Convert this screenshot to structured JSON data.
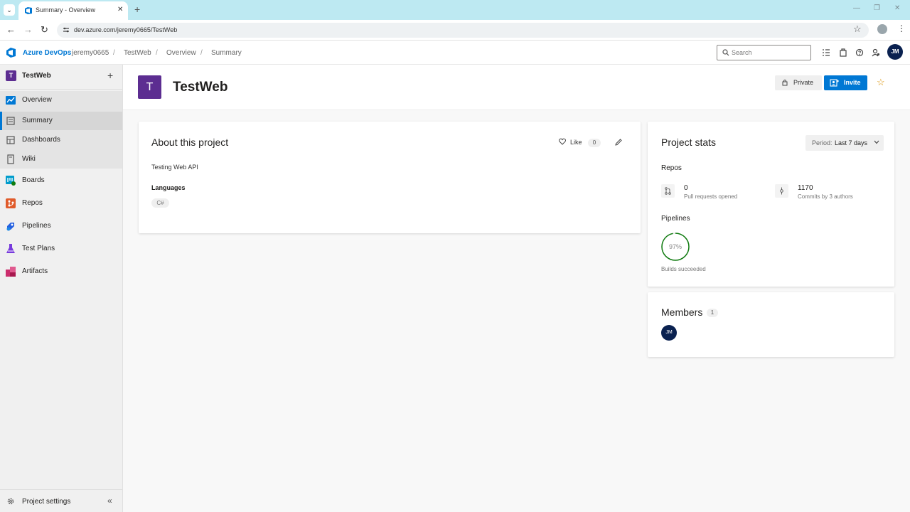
{
  "browser": {
    "tab_title": "Summary - Overview",
    "url": "dev.azure.com/jeremy0665/TestWeb"
  },
  "header": {
    "brand": "Azure DevOps",
    "breadcrumb": [
      "jeremy0665",
      "TestWeb",
      "Overview",
      "Summary"
    ],
    "search_placeholder": "Search",
    "user_initials": "JM"
  },
  "sidebar": {
    "project_initial": "T",
    "project_name": "TestWeb",
    "items": [
      {
        "label": "Overview",
        "icon": "overview-icon"
      },
      {
        "label": "Summary",
        "icon": "summary-icon",
        "selected": true
      },
      {
        "label": "Dashboards",
        "icon": "dashboards-icon"
      },
      {
        "label": "Wiki",
        "icon": "wiki-icon"
      },
      {
        "label": "Boards",
        "icon": "boards-icon"
      },
      {
        "label": "Repos",
        "icon": "repos-icon"
      },
      {
        "label": "Pipelines",
        "icon": "pipelines-icon"
      },
      {
        "label": "Test Plans",
        "icon": "test-plans-icon"
      },
      {
        "label": "Artifacts",
        "icon": "artifacts-icon"
      }
    ],
    "settings_label": "Project settings"
  },
  "project": {
    "initial": "T",
    "title": "TestWeb",
    "private_label": "Private",
    "invite_label": "Invite"
  },
  "about": {
    "title": "About this project",
    "like_label": "Like",
    "like_count": "0",
    "description": "Testing Web API",
    "languages_title": "Languages",
    "languages": [
      "C#"
    ]
  },
  "stats": {
    "title": "Project stats",
    "period_label": "Period:",
    "period_value": "Last 7 days",
    "repos_label": "Repos",
    "pull_requests_value": "0",
    "pull_requests_sub": "Pull requests opened",
    "commits_value": "1170",
    "commits_sub": "Commits by 3 authors",
    "pipelines_label": "Pipelines",
    "builds_percent": "97%",
    "builds_fraction": 0.97,
    "builds_sub": "Builds succeeded"
  },
  "members": {
    "title": "Members",
    "count": "1",
    "member_initials": "JM"
  },
  "colors": {
    "accent": "#0078d4",
    "project_badge": "#5c2d91",
    "ring_success": "#107c10",
    "avatar": "#0a2150"
  }
}
